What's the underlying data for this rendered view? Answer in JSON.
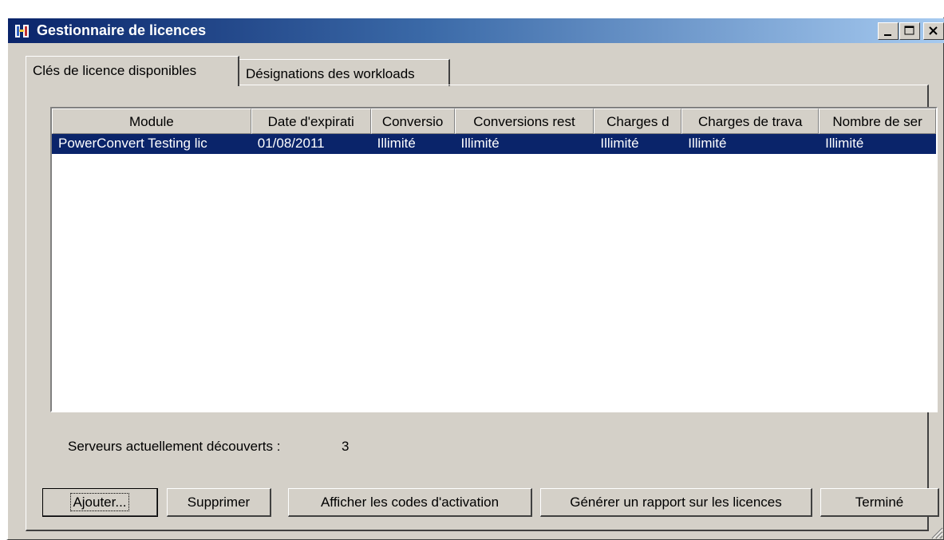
{
  "window": {
    "title": "Gestionnaire de licences"
  },
  "tabs": [
    {
      "label": "Clés de licence disponibles",
      "active": true
    },
    {
      "label": "Désignations des workloads",
      "active": false
    }
  ],
  "table": {
    "columns": [
      "Module",
      "Date d'expirati",
      "Conversio",
      "Conversions rest",
      "Charges d",
      "Charges de trava",
      "Nombre de ser"
    ],
    "rows": [
      [
        "PowerConvert Testing lic",
        "01/08/2011",
        "Illimité",
        "Illimité",
        "Illimité",
        "Illimité",
        "Illimité"
      ]
    ],
    "selected_row": 0
  },
  "servers": {
    "label": "Serveurs actuellement découverts :",
    "value": "3"
  },
  "buttons": {
    "add": "Ajouter...",
    "delete": "Supprimer",
    "activation": "Afficher les codes d'activation",
    "report": "Générer un rapport sur les licences",
    "done": "Terminé"
  },
  "colors": {
    "titlebar_start": "#0a246a",
    "titlebar_end": "#a6caf0",
    "selection": "#0a246a",
    "face": "#d4d0c8"
  }
}
